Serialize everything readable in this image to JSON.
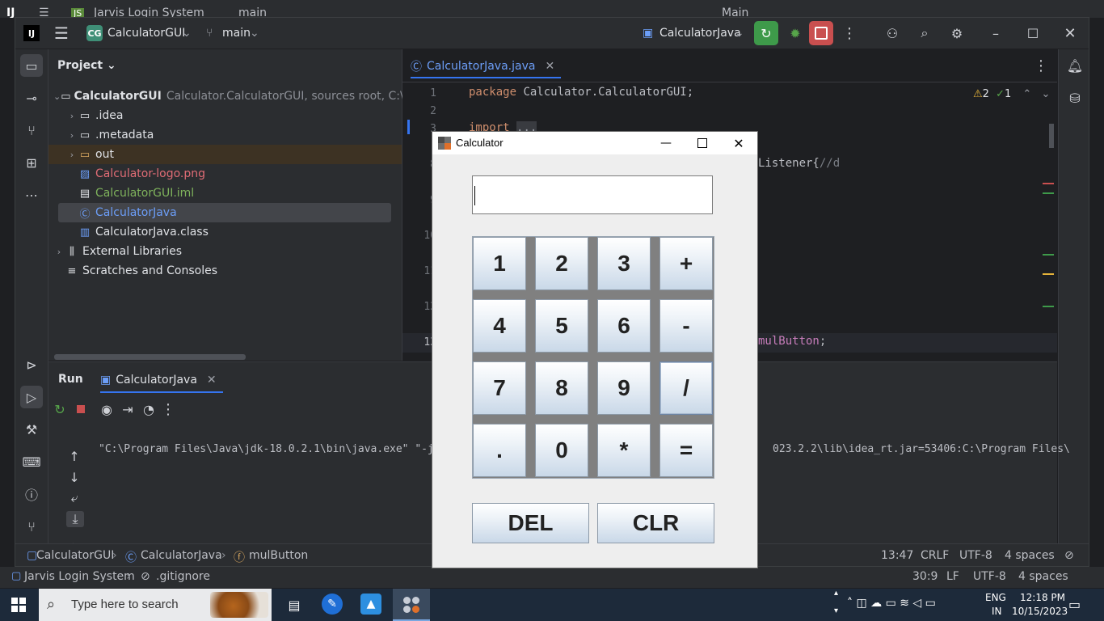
{
  "back_window": {
    "app": "Jarvis Login System",
    "branch": "main",
    "run_config": "Main"
  },
  "ide": {
    "project_badge": "CG",
    "project_name": "CalculatorGUI",
    "branch": "main",
    "run_config": "CalculatorJava"
  },
  "project_panel": {
    "title": "Project",
    "root_name": "CalculatorGUI",
    "root_hint": "Calculator.CalculatorGUI,  sources root,  C:\\Users",
    "items": [
      {
        "label": "CalculatorGUI",
        "kind": "root"
      },
      {
        "label": ".idea",
        "kind": "folder"
      },
      {
        "label": ".metadata",
        "kind": "folder"
      },
      {
        "label": "out",
        "kind": "folder"
      },
      {
        "label": "Calculator-logo.png",
        "kind": "image"
      },
      {
        "label": "CalculatorGUI.iml",
        "kind": "module"
      },
      {
        "label": "CalculatorJava",
        "kind": "class"
      },
      {
        "label": "CalculatorJava.class",
        "kind": "compiled"
      },
      {
        "label": "External Libraries",
        "kind": "library"
      },
      {
        "label": "Scratches and Consoles",
        "kind": "scratch"
      }
    ]
  },
  "editor": {
    "tab_label": "CalculatorJava.java",
    "warnings": "2",
    "ok_count": "1",
    "lines": [
      {
        "num": "1",
        "text": "package Calculator.CalculatorGUI;"
      },
      {
        "num": "2",
        "text": ""
      },
      {
        "num": "3",
        "text": "import ..."
      },
      {
        "num": "8",
        "text": "Listener{//d"
      },
      {
        "num": "9",
        "text": ""
      },
      {
        "num": "10",
        "text": ""
      },
      {
        "num": "11",
        "text": ""
      },
      {
        "num": "12",
        "text": ""
      },
      {
        "num": "13",
        "text": "mulButton;"
      }
    ]
  },
  "run_panel": {
    "title": "Run",
    "tab_label": "CalculatorJava",
    "output_left": "\"C:\\Program Files\\Java\\jdk-18.0.2.1\\bin\\java.exe\" \"-ja",
    "output_right": "023.2.2\\lib\\idea_rt.jar=53406:C:\\Program Files\\"
  },
  "status_bar": {
    "crumbs": [
      "CalculatorGUI",
      "CalculatorJava",
      "mulButton"
    ],
    "position": "13:47",
    "line_sep": "CRLF",
    "encoding": "UTF-8",
    "indent": "4 spaces"
  },
  "outer_status": {
    "project": "Jarvis Login System",
    "file": ".gitignore",
    "position": "30:9",
    "line_sep": "LF",
    "encoding": "UTF-8",
    "indent": "4 spaces"
  },
  "calculator": {
    "title": "Calculator",
    "display_value": "",
    "buttons": [
      "1",
      "2",
      "3",
      "+",
      "4",
      "5",
      "6",
      "-",
      "7",
      "8",
      "9",
      "/",
      ".",
      "0",
      "*",
      "="
    ],
    "del_label": "DEL",
    "clr_label": "CLR"
  },
  "taskbar": {
    "search_placeholder": "Type here to search",
    "language": "ENG",
    "region": "IN",
    "time": "12:18 PM",
    "date": "10/15/2023"
  },
  "colors": {
    "accent_green": "#3e9a4a",
    "stop_red": "#c94f4f",
    "error_file": "#e06c75",
    "module_file": "#7fb35c",
    "class_file": "#6c9ef8"
  }
}
